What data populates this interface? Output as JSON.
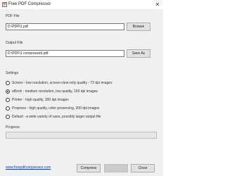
{
  "window": {
    "title": "Free PDF Compressor",
    "icon": "pdf-app-icon",
    "close_glyph": "✕"
  },
  "pdf_file": {
    "label": "PDF File",
    "value": "D:\\PDF\\1.pdf",
    "browse_label": "Browse"
  },
  "output_file": {
    "label": "Output File",
    "value": "D:\\PDF\\1 compressed.pdf",
    "save_as_label": "Save As"
  },
  "settings": {
    "label": "Settings",
    "selected_index": 1,
    "options": [
      {
        "label": "Screen - low resolution, screen-view-only quality - 72 dpi images"
      },
      {
        "label": "eBook - medium resolution, low quality, 150 dpi images"
      },
      {
        "label": "Printer - high quality, 300 dpi images"
      },
      {
        "label": "Prepress - high quality, color preserving, 300 dpi images"
      },
      {
        "label": "Default - a wide variety of uses, possibly larger output file"
      }
    ]
  },
  "progress": {
    "label": "Progress",
    "fraction": 0
  },
  "footer": {
    "link_text": "www.freepdfcompressor.com",
    "compress_label": "Compress",
    "close_label": "Close"
  },
  "colors": {
    "window_bg": "#f0f0f0",
    "link": "#0645ad",
    "progress_fill": "#06b025"
  }
}
